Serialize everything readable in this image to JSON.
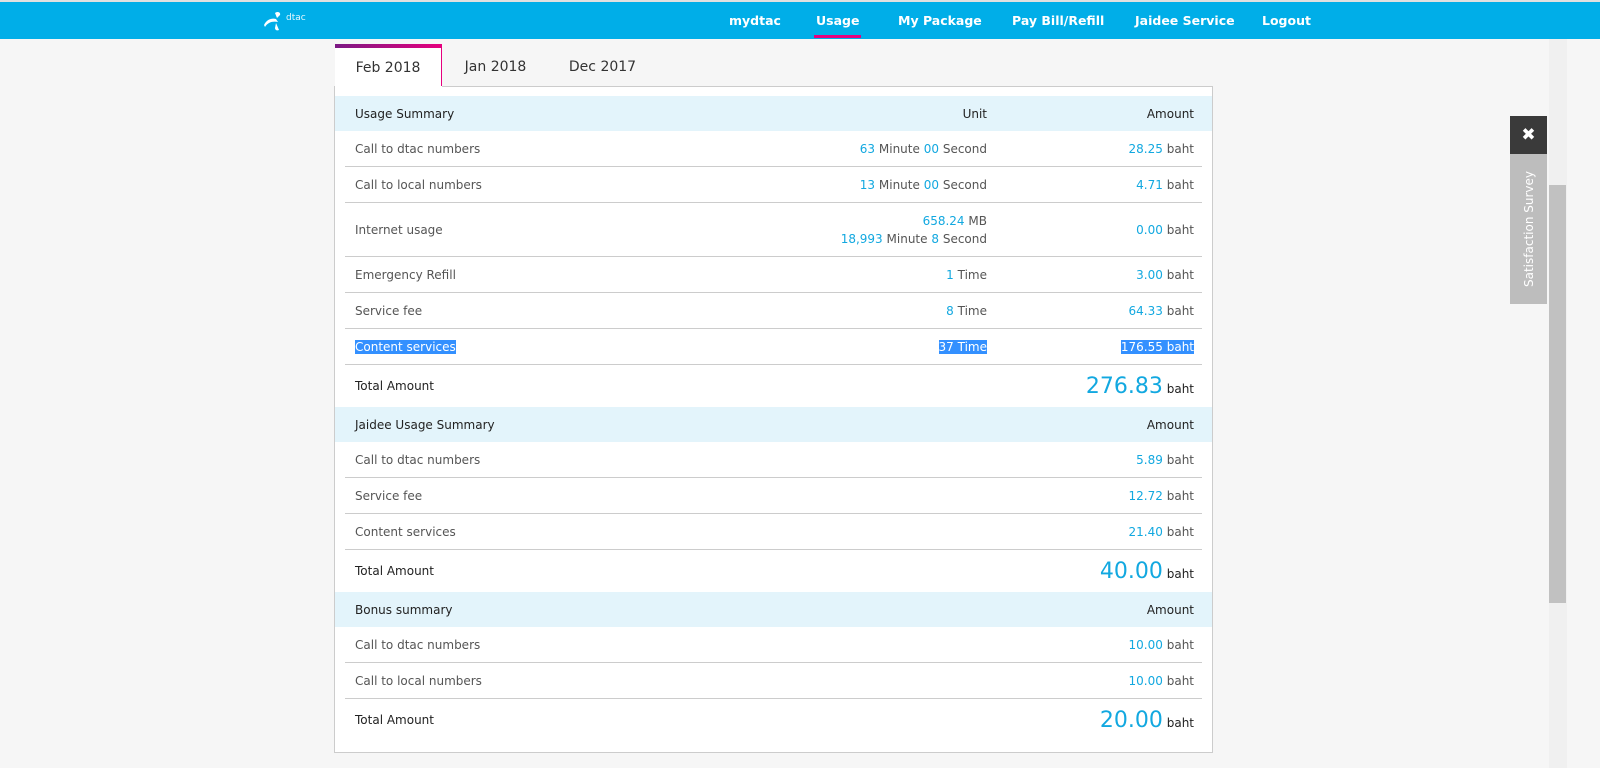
{
  "brand": "dtac",
  "nav": [
    {
      "label": "mydtac"
    },
    {
      "label": "Usage",
      "active": true
    },
    {
      "label": "My Package"
    },
    {
      "label": "Pay Bill/Refill"
    },
    {
      "label": "Jaidee Service"
    },
    {
      "label": "Logout"
    }
  ],
  "tabs": [
    {
      "label": "Feb 2018",
      "active": true
    },
    {
      "label": "Jan 2018"
    },
    {
      "label": "Dec 2017"
    }
  ],
  "sections": [
    {
      "title": "Usage Summary",
      "unit_header": "Unit",
      "amount_header": "Amount",
      "rows": [
        {
          "label": "Call to dtac numbers",
          "unit_lines": [
            [
              {
                "v": "63"
              },
              {
                "t": "Minute"
              },
              {
                "v": "00"
              },
              {
                "t": "Second"
              }
            ]
          ],
          "amount": "28.25",
          "currency": "baht"
        },
        {
          "label": "Call to local numbers",
          "unit_lines": [
            [
              {
                "v": "13"
              },
              {
                "t": "Minute"
              },
              {
                "v": "00"
              },
              {
                "t": "Second"
              }
            ]
          ],
          "amount": "4.71",
          "currency": "baht"
        },
        {
          "label": "Internet usage",
          "unit_lines": [
            [
              {
                "v": "658.24"
              },
              {
                "t": "MB"
              }
            ],
            [
              {
                "v": "18,993"
              },
              {
                "t": "Minute"
              },
              {
                "v": "8"
              },
              {
                "t": "Second"
              }
            ]
          ],
          "amount": "0.00",
          "currency": "baht"
        },
        {
          "label": "Emergency Refill",
          "unit_lines": [
            [
              {
                "v": "1"
              },
              {
                "t": "Time"
              }
            ]
          ],
          "amount": "3.00",
          "currency": "baht"
        },
        {
          "label": "Service fee",
          "unit_lines": [
            [
              {
                "v": "8"
              },
              {
                "t": "Time"
              }
            ]
          ],
          "amount": "64.33",
          "currency": "baht"
        },
        {
          "label": "Content services",
          "unit_lines": [
            [
              {
                "v": "37"
              },
              {
                "t": "Time"
              }
            ]
          ],
          "amount": "176.55",
          "currency": "baht",
          "selected": true
        }
      ],
      "total_label": "Total Amount",
      "total": "276.83",
      "total_currency": "baht"
    },
    {
      "title": "Jaidee Usage Summary",
      "amount_header": "Amount",
      "rows": [
        {
          "label": "Call to dtac numbers",
          "amount": "5.89",
          "currency": "baht"
        },
        {
          "label": "Service fee",
          "amount": "12.72",
          "currency": "baht"
        },
        {
          "label": "Content services",
          "amount": "21.40",
          "currency": "baht"
        }
      ],
      "total_label": "Total Amount",
      "total": "40.00",
      "total_currency": "baht"
    },
    {
      "title": "Bonus summary",
      "amount_header": "Amount",
      "rows": [
        {
          "label": "Call to dtac numbers",
          "amount": "10.00",
          "currency": "baht"
        },
        {
          "label": "Call to local numbers",
          "amount": "10.00",
          "currency": "baht"
        }
      ],
      "total_label": "Total Amount",
      "total": "20.00",
      "total_currency": "baht"
    }
  ],
  "survey": {
    "close_icon": "close-icon",
    "label": "Satisfaction Survey"
  },
  "colors": {
    "brand": "#00aee8",
    "accent": "#e6007e",
    "value": "#12a8e0"
  }
}
